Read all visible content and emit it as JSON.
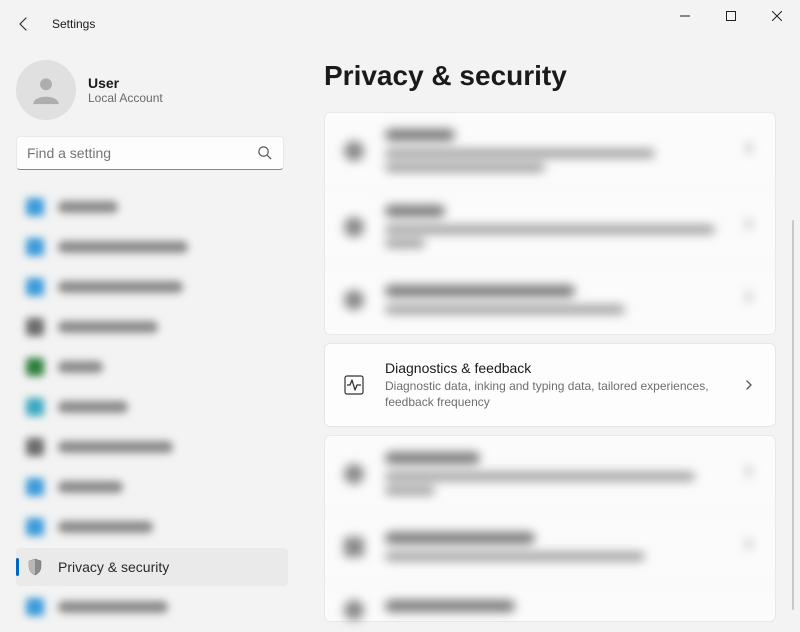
{
  "app_title": "Settings",
  "user": {
    "name": "User",
    "account_type": "Local Account"
  },
  "search": {
    "placeholder": "Find a setting"
  },
  "sidebar": {
    "active_item": {
      "label": "Privacy & security"
    }
  },
  "page": {
    "title": "Privacy & security"
  },
  "highlighted_setting": {
    "title": "Diagnostics & feedback",
    "subtitle": "Diagnostic data, inking and typing data, tailored experiences, feedback frequency"
  }
}
